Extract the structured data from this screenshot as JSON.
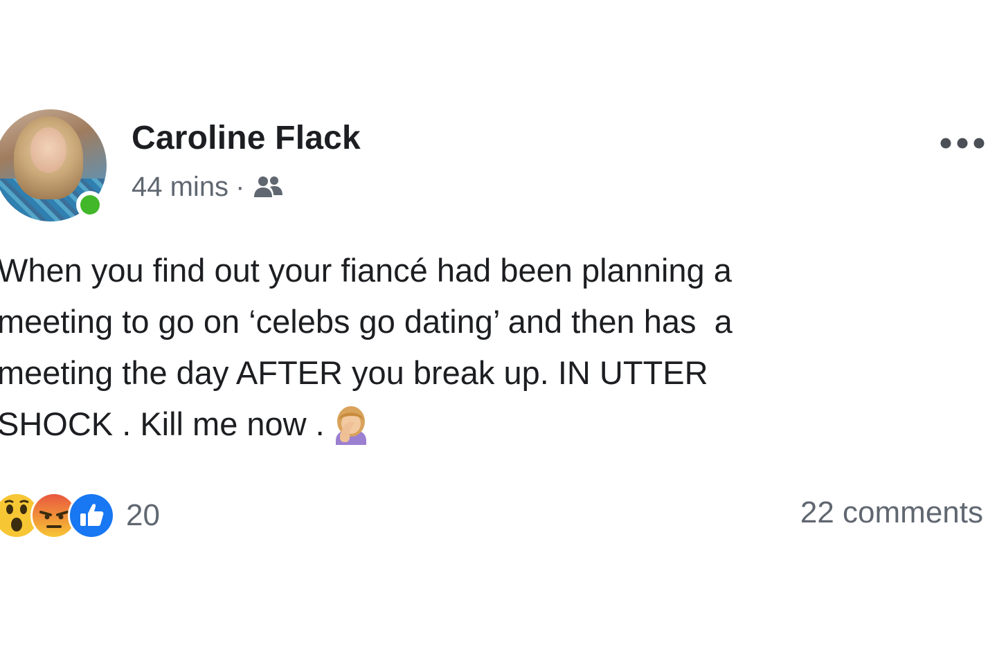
{
  "post": {
    "author": "Caroline Flack",
    "timestamp": "44 mins",
    "separator": "·",
    "audience_icon": "friends-icon",
    "more_icon": "more-options-icon",
    "avatar_icon": "profile-photo",
    "online": true,
    "message": "When you find out your fiancé had been planning a\nmeeting to go on ‘celebs go dating’ and then has  a\nmeeting the day AFTER you break up. IN UTTER\nSHOCK . Kill me now .",
    "emoji": "woman-facepalming-icon"
  },
  "footer": {
    "reactions": [
      "wow-reaction-icon",
      "angry-reaction-icon",
      "like-reaction-icon"
    ],
    "reaction_count": "20",
    "comments_label": "22 comments"
  },
  "colors": {
    "online_green": "#42b72a",
    "like_blue": "#1877f2",
    "secondary_text": "#606770",
    "primary_text": "#1c1e21"
  }
}
